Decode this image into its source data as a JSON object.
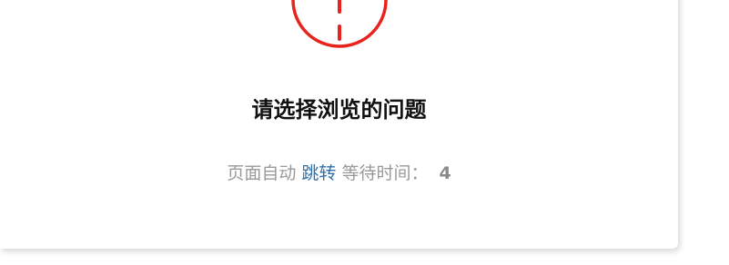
{
  "notice": {
    "title": "请选择浏览的问题",
    "redirect_prefix": "页面自动",
    "redirect_link": "跳转",
    "redirect_wait": "等待时间：",
    "countdown": "4"
  },
  "icon": {
    "name": "warning-exclamation-icon",
    "color": "#e8231e"
  },
  "colors": {
    "link": "#2f6fa8",
    "muted_text": "#999999",
    "title_text": "#111111"
  }
}
